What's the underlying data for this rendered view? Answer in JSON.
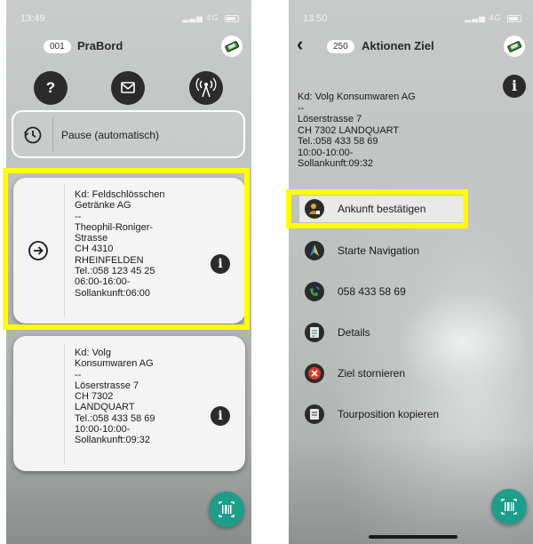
{
  "left_screen": {
    "status": {
      "time": "13:49",
      "network": "4G"
    },
    "header": {
      "badge": "001",
      "title": "PraBord"
    },
    "actions": {
      "help_label": "?"
    },
    "pause": {
      "label": "Pause (automatisch)"
    },
    "cards": [
      {
        "address": "Kd: Feldschlösschen\nGetränke AG\n--\nTheophil-Roniger-\nStrasse\nCH 4310\nRHEINFELDEN\nTel.:058 123 45 25\n06:00-16:00-\nSollankunft:06:00"
      },
      {
        "address": "Kd: Volg\nKonsumwaren AG\n--\nLöserstrasse 7\nCH 7302\nLANDQUART\nTel.:058 433 58 69\n10:00-10:00-\nSollankunft:09:32"
      }
    ]
  },
  "right_screen": {
    "status": {
      "time": "13:50",
      "network": "4G"
    },
    "header": {
      "badge": "250",
      "title": "Aktionen Ziel"
    },
    "destination": "Kd: Volg Konsumwaren AG\n--\nLöserstrasse 7\nCH 7302 LANDQUART\nTel.:058 433 58 69\n10:00-10:00-\nSollankunft:09:32",
    "actions": [
      {
        "label": "Ankunft bestätigen",
        "icon": "arrival-icon",
        "color": "#d9882b"
      },
      {
        "label": "Starte Navigation",
        "icon": "navigation-icon",
        "color": "#2f8fd0"
      },
      {
        "label": "058 433 58 69",
        "icon": "phone-icon",
        "color": "#3a9b5a"
      },
      {
        "label": "Details",
        "icon": "details-icon",
        "color": "#3b9e9a"
      },
      {
        "label": "Ziel stornieren",
        "icon": "cancel-icon",
        "color": "#d83a2e"
      },
      {
        "label": "Tourposition kopieren",
        "icon": "copy-icon",
        "color": "#3b9e9a"
      }
    ]
  },
  "colors": {
    "highlight": "#ffff00",
    "fab": "#1e9e8a",
    "dark_button": "#2b2b2b"
  }
}
